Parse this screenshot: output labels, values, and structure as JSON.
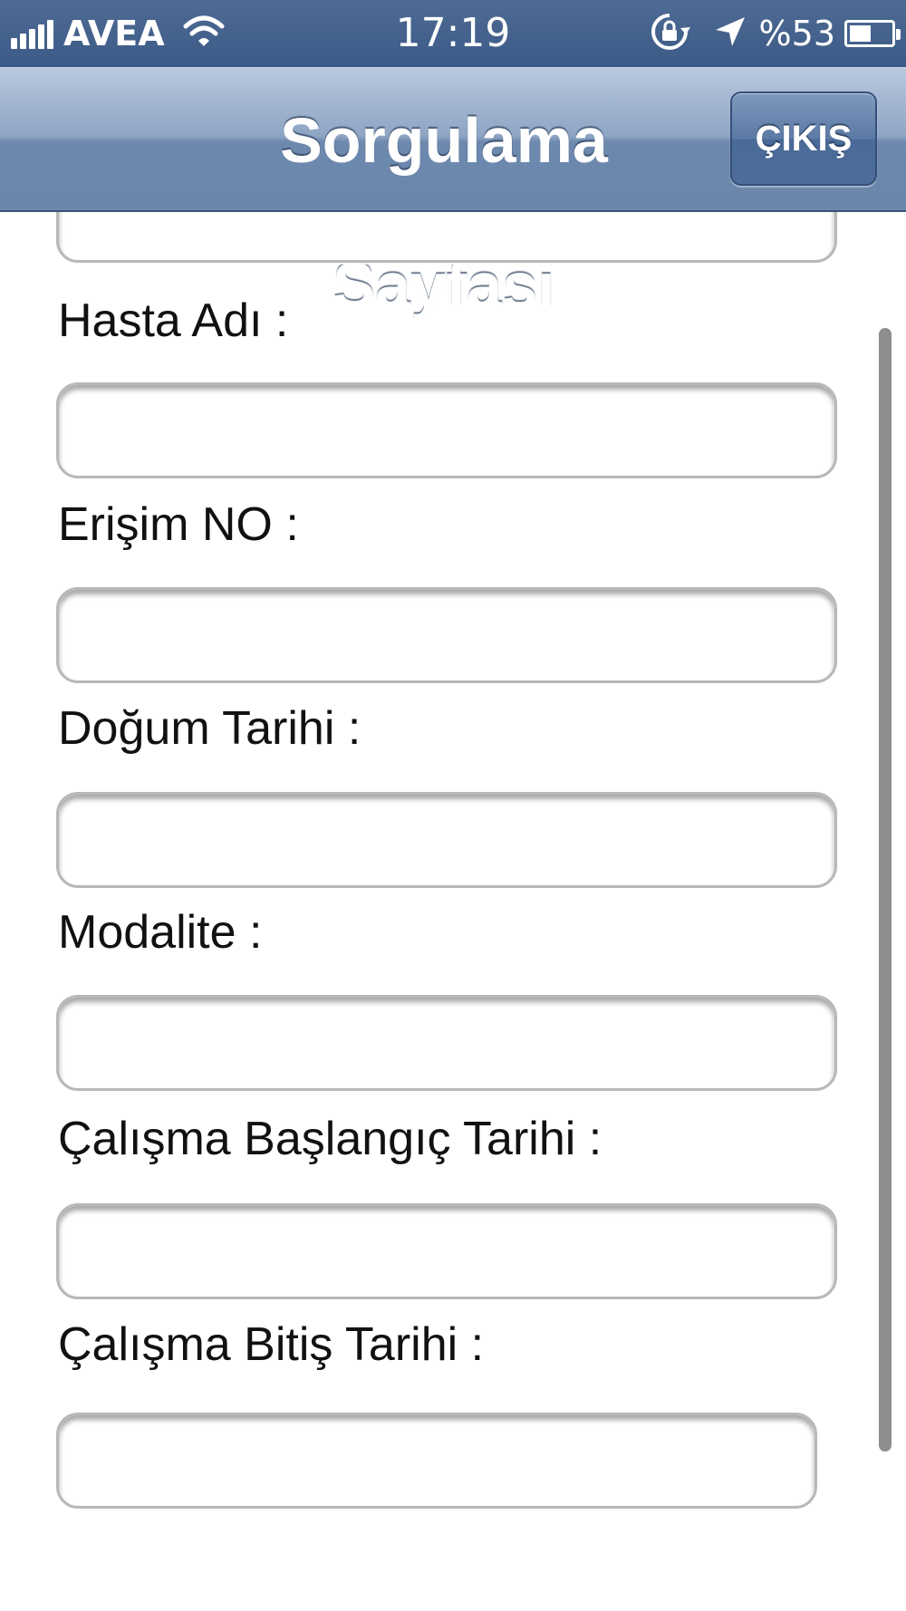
{
  "status_bar": {
    "carrier": "AVEA",
    "time": "17:19",
    "battery_text": "%53",
    "battery_level": 0.53,
    "icons": [
      "signal-icon",
      "wifi-icon",
      "rotation-lock-icon",
      "location-arrow-icon",
      "battery-charging-icon"
    ]
  },
  "nav": {
    "title": "Sorgulama Sayfasi",
    "exit_label": "ÇIKIŞ"
  },
  "form": {
    "fields": [
      {
        "label": "Hasta Adı :",
        "value": ""
      },
      {
        "label": "Erişim NO :",
        "value": ""
      },
      {
        "label": "Doğum Tarihi :",
        "value": ""
      },
      {
        "label": "Modalite :",
        "value": ""
      },
      {
        "label": "Çalışma Başlangıç Tarihi :",
        "value": ""
      },
      {
        "label": "Çalışma Bitiş Tarihi :",
        "value": ""
      }
    ]
  },
  "colors": {
    "status_bar": "#3f5d88",
    "nav_bar": "#7f97ba",
    "button": "#4e6d9a"
  }
}
